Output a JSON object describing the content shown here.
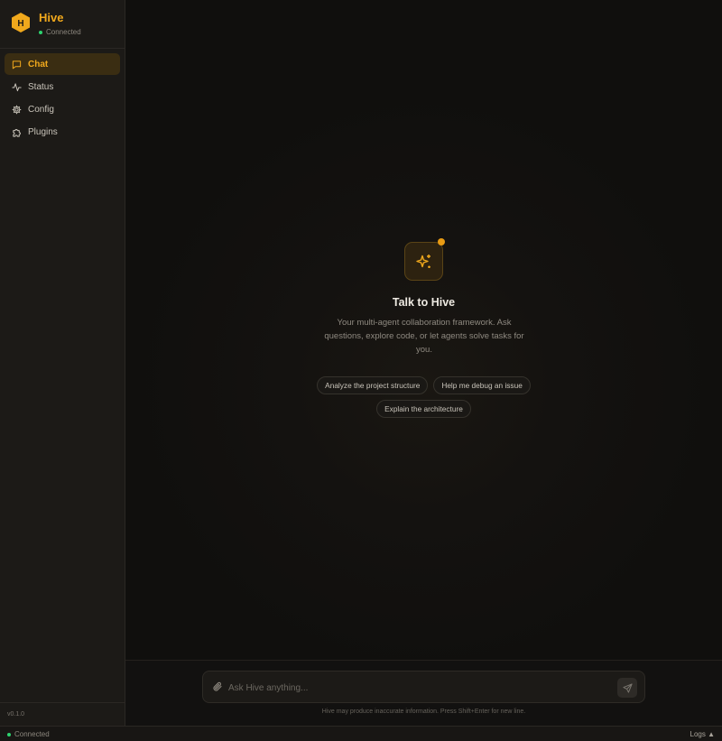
{
  "brand": {
    "logo_letter": "H",
    "name": "Hive",
    "status": "Connected",
    "accent": "#f0a81c"
  },
  "nav": [
    {
      "label": "Chat",
      "icon": "chat-icon",
      "active": true
    },
    {
      "label": "Status",
      "icon": "activity-icon",
      "active": false
    },
    {
      "label": "Config",
      "icon": "gear-icon",
      "active": false
    },
    {
      "label": "Plugins",
      "icon": "puzzle-icon",
      "active": false
    }
  ],
  "version": "v0.1.0",
  "hero": {
    "icon": "sparkles-icon",
    "title": "Talk to Hive",
    "description": "Your multi-agent collaboration framework. Ask questions, explore code, or let agents solve tasks for you."
  },
  "suggestions": [
    "Analyze the project structure",
    "Help me debug an issue",
    "Explain the architecture"
  ],
  "composer": {
    "placeholder": "Ask Hive anything...",
    "value": "",
    "disclaimer": "Hive may produce inaccurate information. Press Shift+Enter for new line."
  },
  "footer": {
    "status": "Connected",
    "logs_label": "Logs ▲"
  }
}
